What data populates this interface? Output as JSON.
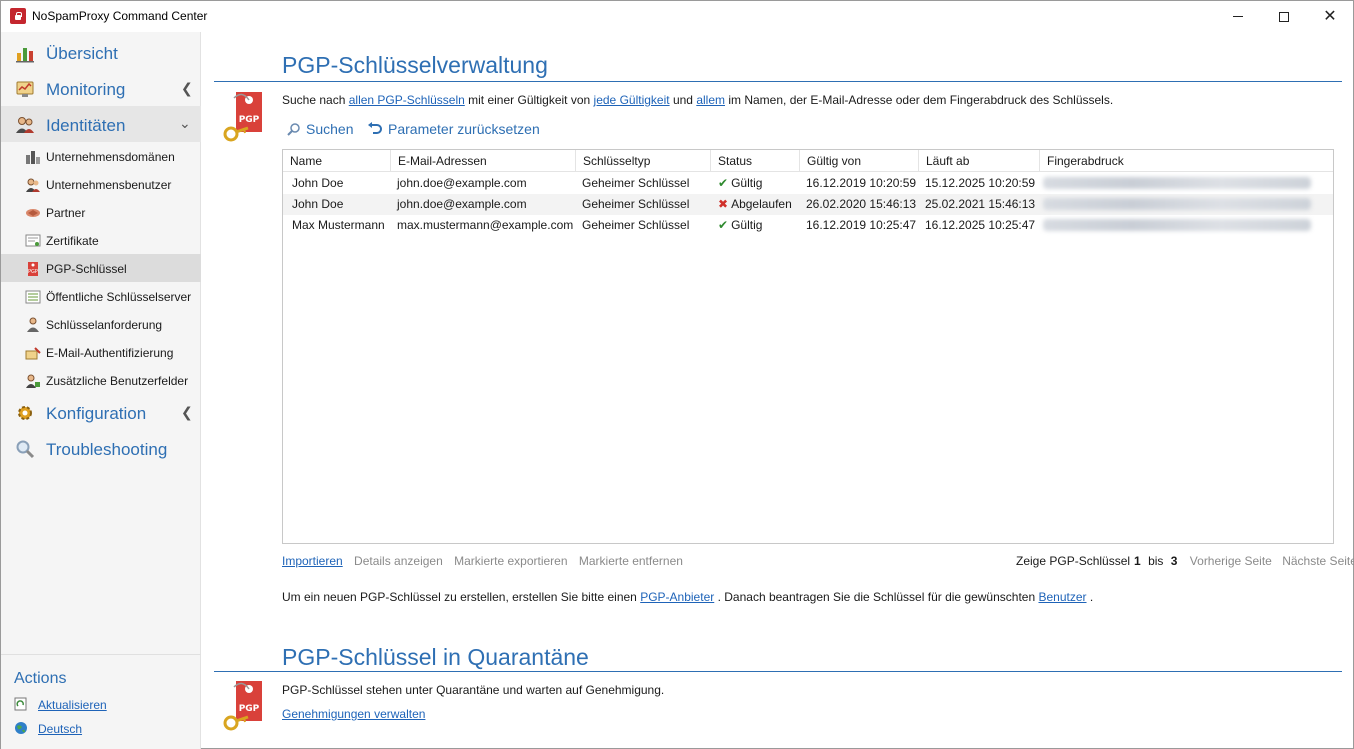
{
  "window": {
    "title": "NoSpamProxy Command Center"
  },
  "sidebar": {
    "main_items": [
      {
        "label": "Übersicht"
      },
      {
        "label": "Monitoring"
      },
      {
        "label": "Identitäten"
      },
      {
        "label": "Konfiguration"
      },
      {
        "label": "Troubleshooting"
      }
    ],
    "sub_items": [
      {
        "label": "Unternehmensdomänen"
      },
      {
        "label": "Unternehmensbenutzer"
      },
      {
        "label": "Partner"
      },
      {
        "label": "Zertifikate"
      },
      {
        "label": "PGP-Schlüssel"
      },
      {
        "label": "Öffentliche Schlüsselserver"
      },
      {
        "label": "Schlüsselanforderung"
      },
      {
        "label": "E-Mail-Authentifizierung"
      },
      {
        "label": "Zusätzliche Benutzerfelder"
      }
    ],
    "actions_title": "Actions",
    "actions": [
      {
        "label": "Aktualisieren"
      },
      {
        "label": "Deutsch"
      }
    ]
  },
  "keys_section": {
    "title": "PGP-Schlüsselverwaltung",
    "search_desc": {
      "part1": "Suche nach",
      "link1": "allen PGP-Schlüsseln",
      "part2": "mit einer Gültigkeit von",
      "link2": "jede Gültigkeit",
      "part3": "und",
      "link3": "allem",
      "part4": "im Namen, der E-Mail-Adresse oder dem Fingerabdruck des Schlüssels."
    },
    "search_button": "Suchen",
    "reset_button": "Parameter zurücksetzen",
    "columns": [
      "Name",
      "E-Mail-Adressen",
      "Schlüsseltyp",
      "Status",
      "Gültig von",
      "Läuft ab",
      "Fingerabdruck"
    ],
    "rows": [
      {
        "name": "John Doe",
        "email": "john.doe@example.com",
        "type": "Geheimer Schlüssel",
        "status": "Gültig",
        "status_kind": "ok",
        "valid_from": "16.12.2019 10:20:59",
        "expires": "15.12.2025 10:20:59"
      },
      {
        "name": "John Doe",
        "email": "john.doe@example.com",
        "type": "Geheimer Schlüssel",
        "status": "Abgelaufen",
        "status_kind": "bad",
        "valid_from": "26.02.2020 15:46:13",
        "expires": "25.02.2021 15:46:13"
      },
      {
        "name": "Max Mustermann",
        "email": "max.mustermann@example.com",
        "type": "Geheimer Schlüssel",
        "status": "Gültig",
        "status_kind": "ok",
        "valid_from": "16.12.2019 10:25:47",
        "expires": "16.12.2025 10:25:47"
      }
    ],
    "footer_actions": {
      "import": "Importieren",
      "details": "Details anzeigen",
      "export": "Markierte exportieren",
      "remove": "Markierte entfernen"
    },
    "pager": {
      "prefix": "Zeige PGP-Schlüssel",
      "from": "1",
      "mid": "bis",
      "to": "3",
      "prev": "Vorherige Seite",
      "next": "Nächste Seite"
    },
    "create_hint": {
      "part1": "Um ein neuen PGP-Schlüssel zu erstellen, erstellen Sie bitte einen",
      "link1": "PGP-Anbieter",
      "part2": ". Danach beantragen Sie die Schlüssel für die gewünschten",
      "link2": "Benutzer",
      "part3": "."
    }
  },
  "quarantine_section": {
    "title": "PGP-Schlüssel in Quarantäne",
    "desc": "PGP-Schlüssel stehen unter Quarantäne und warten auf Genehmigung.",
    "link": "Genehmigungen verwalten"
  },
  "colors": {
    "accent": "#2e6fb3",
    "link": "#1e63b8",
    "ok": "#2f8a2f",
    "error": "#d0302a",
    "pgp_red": "#d9413a"
  }
}
